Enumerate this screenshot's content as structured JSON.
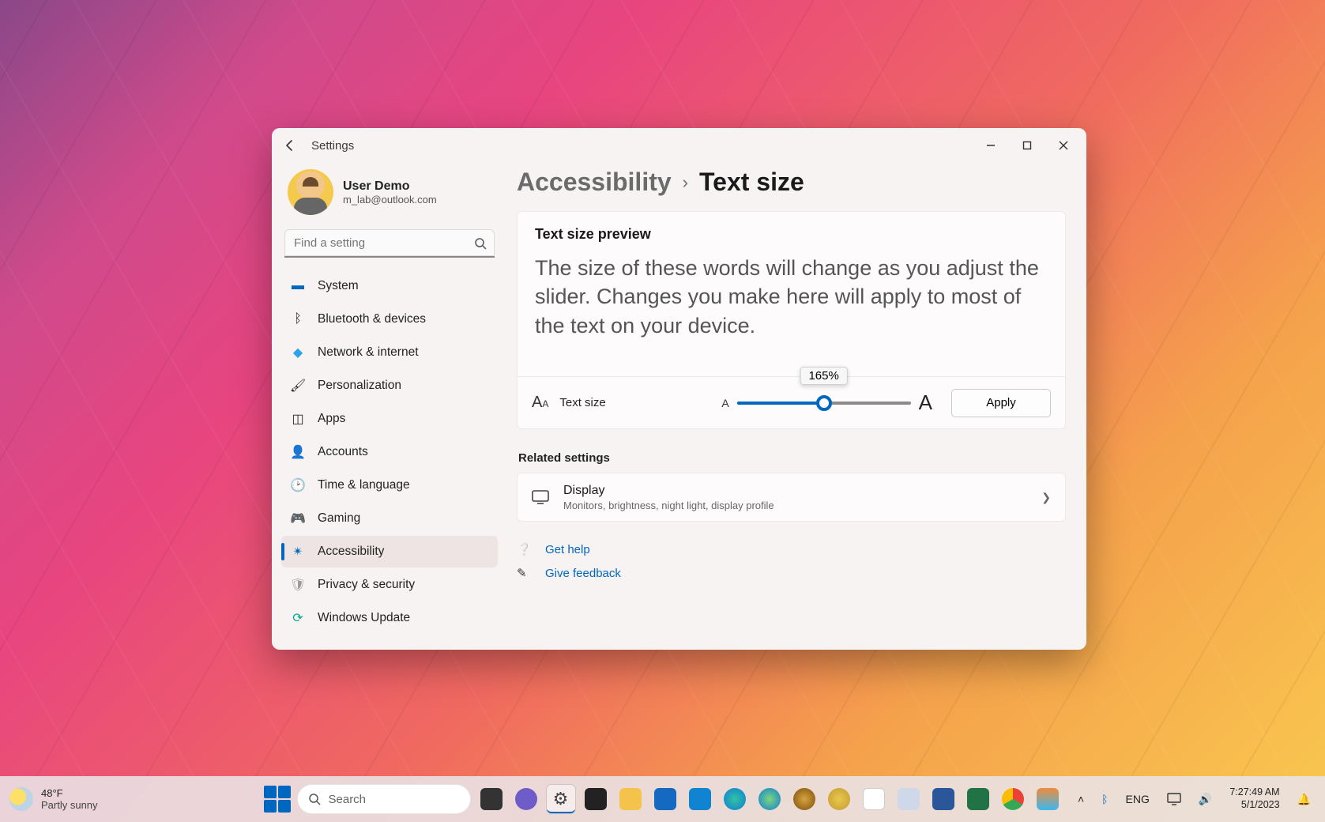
{
  "window": {
    "title": "Settings",
    "user": {
      "name": "User Demo",
      "email": "m_lab@outlook.com"
    },
    "search_placeholder": "Find a setting",
    "nav": [
      {
        "icon": "💻",
        "label": "System"
      },
      {
        "icon": "🔵",
        "label": "Bluetooth & devices"
      },
      {
        "icon": "🔷",
        "label": "Network & internet"
      },
      {
        "icon": "🖌️",
        "label": "Personalization"
      },
      {
        "icon": "🔲",
        "label": "Apps"
      },
      {
        "icon": "👤",
        "label": "Accounts"
      },
      {
        "icon": "🕑",
        "label": "Time & language"
      },
      {
        "icon": "🎮",
        "label": "Gaming"
      },
      {
        "icon": "♿",
        "label": "Accessibility",
        "selected": true
      },
      {
        "icon": "🛡️",
        "label": "Privacy & security"
      },
      {
        "icon": "🔄",
        "label": "Windows Update"
      }
    ],
    "breadcrumb": {
      "parent": "Accessibility",
      "current": "Text size"
    },
    "preview": {
      "heading": "Text size preview",
      "body": "The size of these words will change as you adjust the slider. Changes you make here will apply to most of the text on your device."
    },
    "slider": {
      "label": "Text size",
      "value_label": "165%",
      "percent": 50,
      "apply": "Apply"
    },
    "related": {
      "title": "Related settings",
      "display": {
        "title": "Display",
        "sub": "Monitors, brightness, night light, display profile"
      }
    },
    "help": "Get help",
    "feedback": "Give feedback"
  },
  "taskbar": {
    "weather": {
      "temp": "48°F",
      "desc": "Partly sunny"
    },
    "search_placeholder": "Search",
    "lang": "ENG",
    "time": "7:27:49 AM",
    "date": "5/1/2023"
  }
}
